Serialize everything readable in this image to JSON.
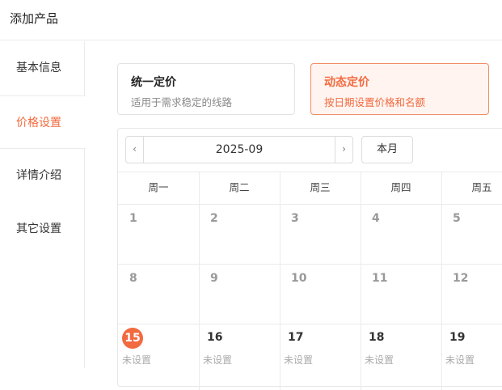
{
  "header": {
    "title": "添加产品"
  },
  "sidebar": {
    "items": [
      {
        "label": "基本信息",
        "active": false
      },
      {
        "label": "价格设置",
        "active": true
      },
      {
        "label": "详情介绍",
        "active": false
      },
      {
        "label": "其它设置",
        "active": false
      }
    ]
  },
  "pricing_options": [
    {
      "title": "统一定价",
      "desc": "适用于需求稳定的线路",
      "selected": false
    },
    {
      "title": "动态定价",
      "desc": "按日期设置价格和名额",
      "selected": true
    }
  ],
  "calendar": {
    "month": "2025-09",
    "prev_icon": "chevron-left-icon",
    "next_icon": "chevron-right-icon",
    "this_month_label": "本月",
    "weekdays": [
      "周一",
      "周二",
      "周三",
      "周四",
      "周五"
    ],
    "weeks": [
      [
        {
          "day": "1",
          "status": ""
        },
        {
          "day": "2",
          "status": ""
        },
        {
          "day": "3",
          "status": ""
        },
        {
          "day": "4",
          "status": ""
        },
        {
          "day": "5",
          "status": ""
        }
      ],
      [
        {
          "day": "8",
          "status": ""
        },
        {
          "day": "9",
          "status": ""
        },
        {
          "day": "10",
          "status": ""
        },
        {
          "day": "11",
          "status": ""
        },
        {
          "day": "12",
          "status": ""
        }
      ],
      [
        {
          "day": "15",
          "status": "未设置",
          "today": true
        },
        {
          "day": "16",
          "status": "未设置"
        },
        {
          "day": "17",
          "status": "未设置"
        },
        {
          "day": "18",
          "status": "未设置"
        },
        {
          "day": "19",
          "status": "未设置"
        }
      ]
    ]
  },
  "colors": {
    "accent": "#f26a3f",
    "accent_bg": "#fff4f0",
    "border": "#ebebeb"
  }
}
